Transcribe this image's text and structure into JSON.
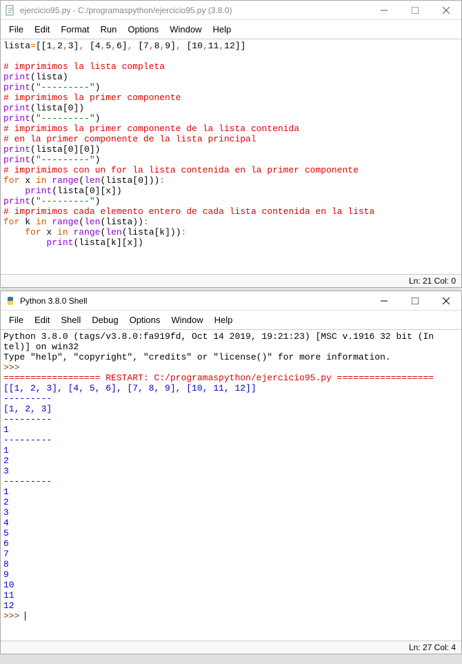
{
  "editor": {
    "title": "ejercicio95.py - C:/programaspython/ejercicio95.py (3.8.0)",
    "menus": [
      "File",
      "Edit",
      "Format",
      "Run",
      "Options",
      "Window",
      "Help"
    ],
    "code": [
      {
        "segments": [
          [
            "black",
            "lista"
          ],
          [
            "orange",
            "="
          ],
          [
            "black",
            "[["
          ],
          [
            "black",
            "1"
          ],
          [
            "orange",
            ","
          ],
          [
            "black",
            "2"
          ],
          [
            "orange",
            ","
          ],
          [
            "black",
            "3"
          ],
          [
            "black",
            "]"
          ],
          [
            "orange",
            ","
          ],
          [
            "black",
            " ["
          ],
          [
            "black",
            "4"
          ],
          [
            "orange",
            ","
          ],
          [
            "black",
            "5"
          ],
          [
            "orange",
            ","
          ],
          [
            "black",
            "6"
          ],
          [
            "black",
            "]"
          ],
          [
            "orange",
            ","
          ],
          [
            "black",
            " ["
          ],
          [
            "black",
            "7"
          ],
          [
            "orange",
            ","
          ],
          [
            "black",
            "8"
          ],
          [
            "orange",
            ","
          ],
          [
            "black",
            "9"
          ],
          [
            "black",
            "]"
          ],
          [
            "orange",
            ","
          ],
          [
            "black",
            " ["
          ],
          [
            "black",
            "10"
          ],
          [
            "orange",
            ","
          ],
          [
            "black",
            "11"
          ],
          [
            "orange",
            ","
          ],
          [
            "black",
            "12"
          ],
          [
            "black",
            "]]"
          ]
        ]
      },
      {
        "segments": []
      },
      {
        "segments": [
          [
            "red",
            "# imprimimos la lista completa"
          ]
        ]
      },
      {
        "segments": [
          [
            "purple",
            "print"
          ],
          [
            "black",
            "(lista)"
          ]
        ]
      },
      {
        "segments": [
          [
            "purple",
            "print"
          ],
          [
            "black",
            "("
          ],
          [
            "green",
            "\"---------\""
          ],
          [
            "black",
            ")"
          ]
        ]
      },
      {
        "segments": [
          [
            "red",
            "# imprimimos la primer componente"
          ]
        ]
      },
      {
        "segments": [
          [
            "purple",
            "print"
          ],
          [
            "black",
            "(lista["
          ],
          [
            "black",
            "0"
          ],
          [
            "black",
            "])"
          ]
        ]
      },
      {
        "segments": [
          [
            "purple",
            "print"
          ],
          [
            "black",
            "("
          ],
          [
            "green",
            "\"---------\""
          ],
          [
            "black",
            ")"
          ]
        ]
      },
      {
        "segments": [
          [
            "red",
            "# imprimimos la primer componente de la lista contenida"
          ]
        ]
      },
      {
        "segments": [
          [
            "red",
            "# en la primer componente de la lista principal"
          ]
        ]
      },
      {
        "segments": [
          [
            "purple",
            "print"
          ],
          [
            "black",
            "(lista["
          ],
          [
            "black",
            "0"
          ],
          [
            "black",
            "]["
          ],
          [
            "black",
            "0"
          ],
          [
            "black",
            "])"
          ]
        ]
      },
      {
        "segments": [
          [
            "purple",
            "print"
          ],
          [
            "black",
            "("
          ],
          [
            "green",
            "\"---------\""
          ],
          [
            "black",
            ")"
          ]
        ]
      },
      {
        "segments": [
          [
            "red",
            "# imprimimos con un for la lista contenida en la primer componente"
          ]
        ]
      },
      {
        "segments": [
          [
            "orange",
            "for"
          ],
          [
            "black",
            " x "
          ],
          [
            "orange",
            "in"
          ],
          [
            "black",
            " "
          ],
          [
            "purple",
            "range"
          ],
          [
            "black",
            "("
          ],
          [
            "purple",
            "len"
          ],
          [
            "black",
            "(lista["
          ],
          [
            "black",
            "0"
          ],
          [
            "black",
            "]))"
          ],
          [
            "orange",
            ":"
          ]
        ]
      },
      {
        "segments": [
          [
            "black",
            "    "
          ],
          [
            "purple",
            "print"
          ],
          [
            "black",
            "(lista["
          ],
          [
            "black",
            "0"
          ],
          [
            "black",
            "][x])"
          ]
        ]
      },
      {
        "segments": [
          [
            "purple",
            "print"
          ],
          [
            "black",
            "("
          ],
          [
            "green",
            "\"---------\""
          ],
          [
            "black",
            ")"
          ]
        ]
      },
      {
        "segments": [
          [
            "red",
            "# imprimimos cada elemento entero de cada lista contenida en la lista"
          ]
        ]
      },
      {
        "segments": [
          [
            "orange",
            "for"
          ],
          [
            "black",
            " k "
          ],
          [
            "orange",
            "in"
          ],
          [
            "black",
            " "
          ],
          [
            "purple",
            "range"
          ],
          [
            "black",
            "("
          ],
          [
            "purple",
            "len"
          ],
          [
            "black",
            "(lista))"
          ],
          [
            "orange",
            ":"
          ]
        ]
      },
      {
        "segments": [
          [
            "black",
            "    "
          ],
          [
            "orange",
            "for"
          ],
          [
            "black",
            " x "
          ],
          [
            "orange",
            "in"
          ],
          [
            "black",
            " "
          ],
          [
            "purple",
            "range"
          ],
          [
            "black",
            "("
          ],
          [
            "purple",
            "len"
          ],
          [
            "black",
            "(lista[k]))"
          ],
          [
            "orange",
            ":"
          ]
        ]
      },
      {
        "segments": [
          [
            "black",
            "        "
          ],
          [
            "purple",
            "print"
          ],
          [
            "black",
            "(lista[k][x])"
          ]
        ]
      }
    ],
    "status": "Ln: 21  Col: 0"
  },
  "shell": {
    "title": "Python 3.8.0 Shell",
    "menus": [
      "File",
      "Edit",
      "Shell",
      "Debug",
      "Options",
      "Window",
      "Help"
    ],
    "lines": [
      {
        "segments": [
          [
            "black",
            "Python 3.8.0 (tags/v3.8.0:fa919fd, Oct 14 2019, 19:21:23) [MSC v.1916 32 bit (In"
          ]
        ]
      },
      {
        "segments": [
          [
            "black",
            "tel)] on win32"
          ]
        ]
      },
      {
        "segments": [
          [
            "black",
            "Type \"help\", \"copyright\", \"credits\" or \"license()\" for more information."
          ]
        ]
      },
      {
        "segments": [
          [
            "brown",
            ">>> "
          ]
        ]
      },
      {
        "segments": [
          [
            "red",
            "================== RESTART: C:/programaspython/ejercicio95.py =================="
          ]
        ]
      },
      {
        "segments": [
          [
            "blue",
            "[[1, 2, 3], [4, 5, 6], [7, 8, 9], [10, 11, 12]]"
          ]
        ]
      },
      {
        "segments": [
          [
            "blue",
            "---------"
          ]
        ]
      },
      {
        "segments": [
          [
            "blue",
            "[1, 2, 3]"
          ]
        ]
      },
      {
        "segments": [
          [
            "blue",
            "---------"
          ]
        ]
      },
      {
        "segments": [
          [
            "blue",
            "1"
          ]
        ]
      },
      {
        "segments": [
          [
            "blue",
            "---------"
          ]
        ]
      },
      {
        "segments": [
          [
            "blue",
            "1"
          ]
        ]
      },
      {
        "segments": [
          [
            "blue",
            "2"
          ]
        ]
      },
      {
        "segments": [
          [
            "blue",
            "3"
          ]
        ]
      },
      {
        "segments": [
          [
            "blue",
            "---------"
          ]
        ]
      },
      {
        "segments": [
          [
            "blue",
            "1"
          ]
        ]
      },
      {
        "segments": [
          [
            "blue",
            "2"
          ]
        ]
      },
      {
        "segments": [
          [
            "blue",
            "3"
          ]
        ]
      },
      {
        "segments": [
          [
            "blue",
            "4"
          ]
        ]
      },
      {
        "segments": [
          [
            "blue",
            "5"
          ]
        ]
      },
      {
        "segments": [
          [
            "blue",
            "6"
          ]
        ]
      },
      {
        "segments": [
          [
            "blue",
            "7"
          ]
        ]
      },
      {
        "segments": [
          [
            "blue",
            "8"
          ]
        ]
      },
      {
        "segments": [
          [
            "blue",
            "9"
          ]
        ]
      },
      {
        "segments": [
          [
            "blue",
            "10"
          ]
        ]
      },
      {
        "segments": [
          [
            "blue",
            "11"
          ]
        ]
      },
      {
        "segments": [
          [
            "blue",
            "12"
          ]
        ]
      },
      {
        "segments": [
          [
            "brown",
            ">>> "
          ]
        ],
        "cursor": true
      }
    ],
    "status": "Ln: 27  Col: 4"
  }
}
